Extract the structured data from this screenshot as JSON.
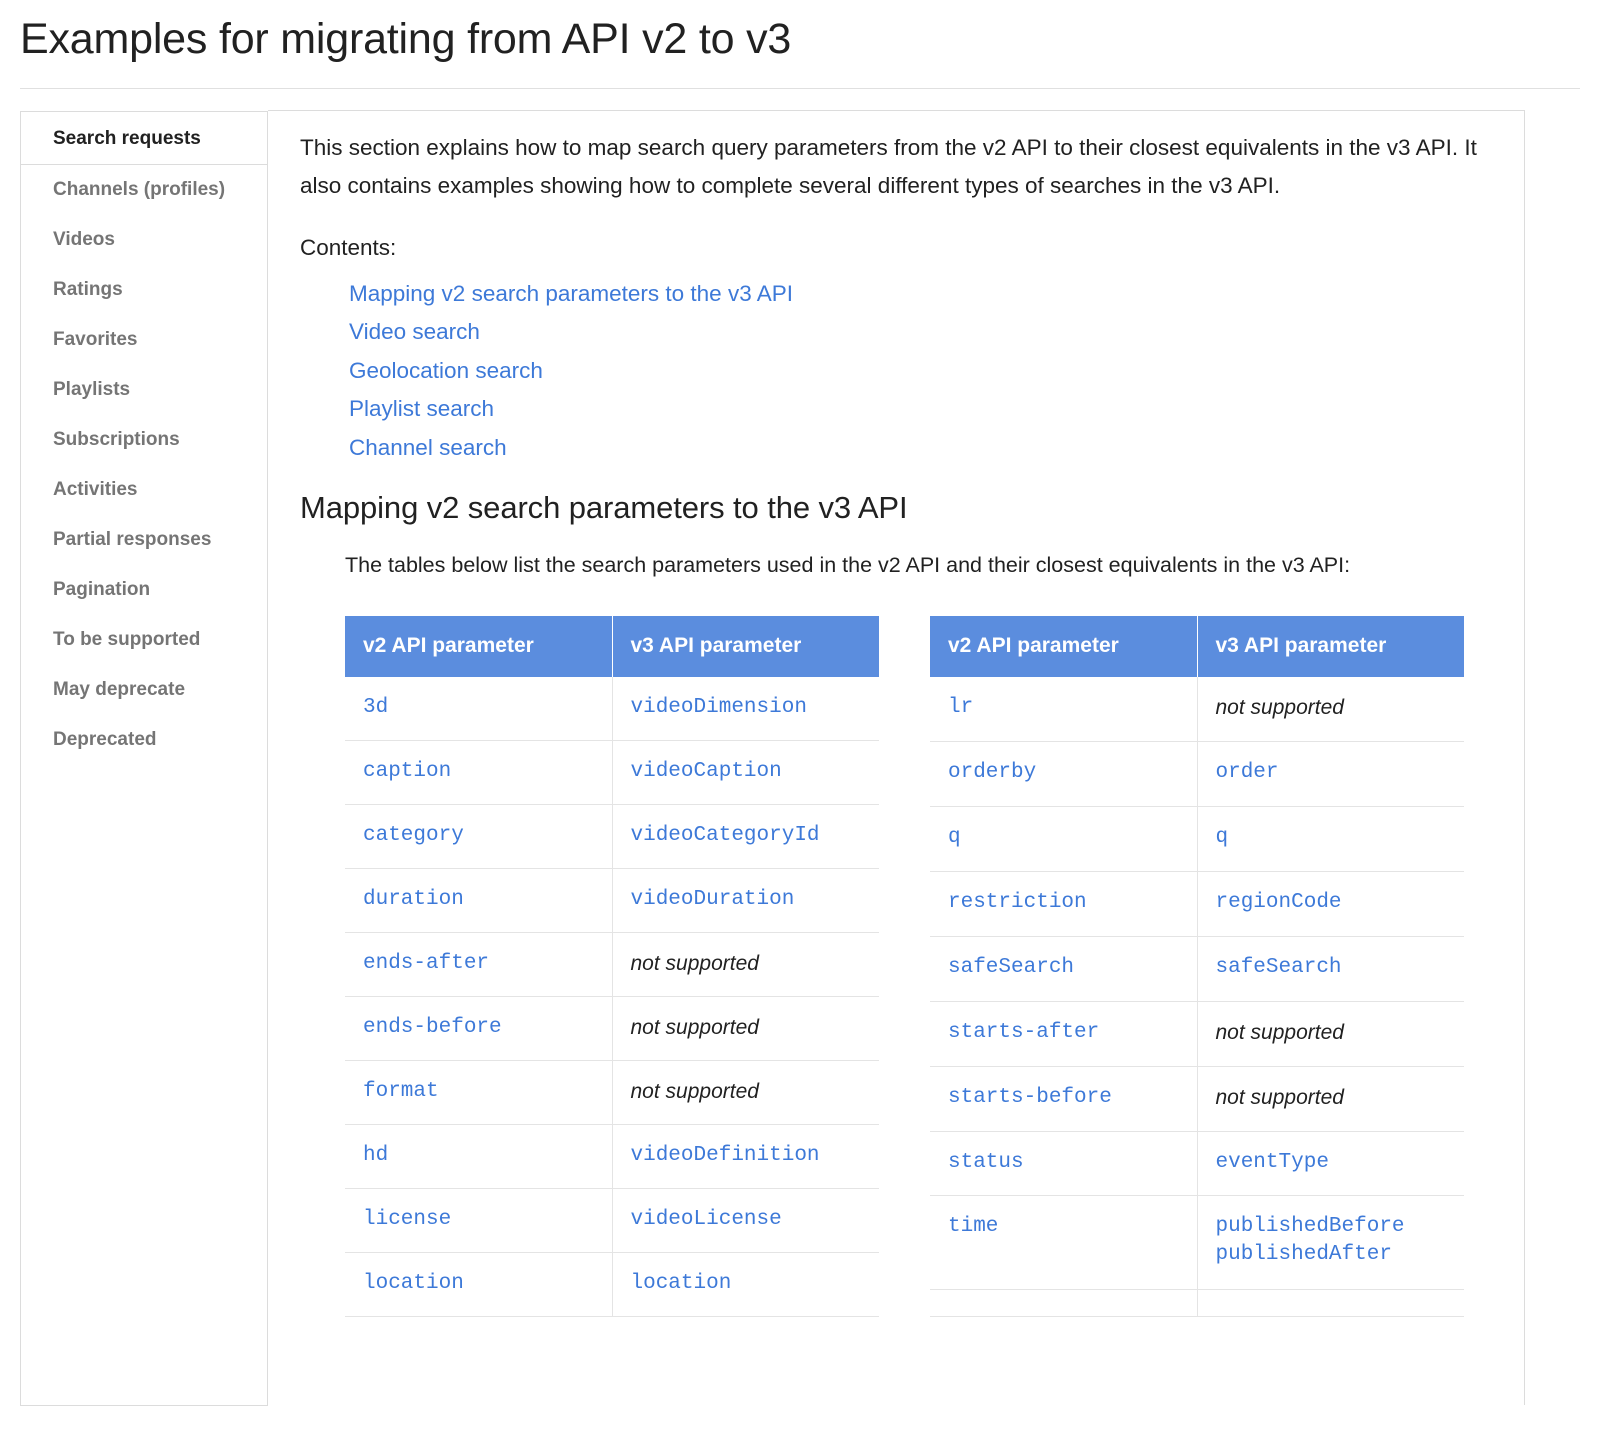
{
  "page": {
    "title": "Examples for migrating from API v2 to v3"
  },
  "colors": {
    "link": "#3d79d8",
    "table_header_bg": "#5b8dde",
    "border": "#dcdcdc",
    "text": "#212121",
    "muted_text": "#757575"
  },
  "sidebar": {
    "items": [
      {
        "label": "Search requests",
        "selected": true
      },
      {
        "label": "Channels (profiles)",
        "selected": false
      },
      {
        "label": "Videos",
        "selected": false
      },
      {
        "label": "Ratings",
        "selected": false
      },
      {
        "label": "Favorites",
        "selected": false
      },
      {
        "label": "Playlists",
        "selected": false
      },
      {
        "label": "Subscriptions",
        "selected": false
      },
      {
        "label": "Activities",
        "selected": false
      },
      {
        "label": "Partial responses",
        "selected": false
      },
      {
        "label": "Pagination",
        "selected": false
      },
      {
        "label": "To be supported",
        "selected": false
      },
      {
        "label": "May deprecate",
        "selected": false
      },
      {
        "label": "Deprecated",
        "selected": false
      }
    ]
  },
  "main": {
    "intro": "This section explains how to map search query parameters from the v2 API to their closest equivalents in the v3 API. It also contains examples showing how to complete several different types of searches in the v3 API.",
    "contents_label": "Contents:",
    "toc": [
      "Mapping v2 search parameters to the v3 API",
      "Video search",
      "Geolocation search",
      "Playlist search",
      "Channel search"
    ],
    "section_heading": "Mapping v2 search parameters to the v3 API",
    "section_intro": "The tables below list the search parameters used in the v2 API and their closest equivalents in the v3 API:",
    "tables": [
      {
        "name": "left",
        "headers": [
          "v2 API parameter",
          "v3 API parameter"
        ],
        "rows": [
          {
            "v2": "3d",
            "v3": "videoDimension",
            "v3_unsupported": false
          },
          {
            "v2": "caption",
            "v3": "videoCaption",
            "v3_unsupported": false
          },
          {
            "v2": "category",
            "v3": "videoCategoryId",
            "v3_unsupported": false
          },
          {
            "v2": "duration",
            "v3": "videoDuration",
            "v3_unsupported": false
          },
          {
            "v2": "ends-after",
            "v3": "not supported",
            "v3_unsupported": true
          },
          {
            "v2": "ends-before",
            "v3": "not supported",
            "v3_unsupported": true
          },
          {
            "v2": "format",
            "v3": "not supported",
            "v3_unsupported": true
          },
          {
            "v2": "hd",
            "v3": "videoDefinition",
            "v3_unsupported": false
          },
          {
            "v2": "license",
            "v3": "videoLicense",
            "v3_unsupported": false
          },
          {
            "v2": "location",
            "v3": "location",
            "v3_unsupported": false
          }
        ]
      },
      {
        "name": "right",
        "headers": [
          "v2 API parameter",
          "v3 API parameter"
        ],
        "rows": [
          {
            "v2": "lr",
            "v3": "not supported",
            "v3_unsupported": true
          },
          {
            "v2": "orderby",
            "v3": "order",
            "v3_unsupported": false
          },
          {
            "v2": "q",
            "v3": "q",
            "v3_unsupported": false
          },
          {
            "v2": "restriction",
            "v3": "regionCode",
            "v3_unsupported": false
          },
          {
            "v2": "safeSearch",
            "v3": "safeSearch",
            "v3_unsupported": false
          },
          {
            "v2": "starts-after",
            "v3": "not supported",
            "v3_unsupported": true
          },
          {
            "v2": "starts-before",
            "v3": "not supported",
            "v3_unsupported": true
          },
          {
            "v2": "status",
            "v3": "eventType",
            "v3_unsupported": false
          },
          {
            "v2": "time",
            "v3": [
              "publishedBefore",
              "publishedAfter"
            ],
            "v3_unsupported": false
          },
          {
            "v2": "",
            "v3": "",
            "v3_unsupported": false
          }
        ]
      }
    ]
  }
}
